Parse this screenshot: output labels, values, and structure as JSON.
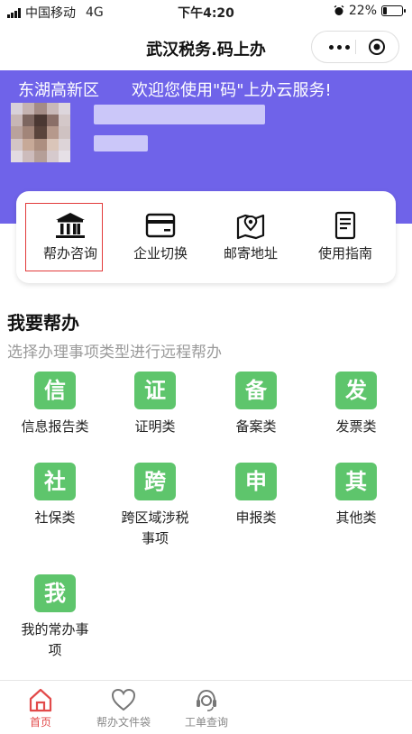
{
  "status_bar": {
    "carrier": "中国移动",
    "network": "4G",
    "time": "下午4:20",
    "battery": "22%",
    "battery_level": 0.22
  },
  "nav": {
    "title": "武汉税务.码上办"
  },
  "hero": {
    "district": "东湖高新区",
    "welcome": "欢迎您使用\"码\"上办云服务!"
  },
  "quick_actions": [
    {
      "label": "帮办咨询",
      "icon": "bank-icon"
    },
    {
      "label": "企业切换",
      "icon": "card-icon"
    },
    {
      "label": "邮寄地址",
      "icon": "map-icon"
    },
    {
      "label": "使用指南",
      "icon": "document-icon"
    }
  ],
  "section": {
    "title": "我要帮办",
    "subtitle": "选择办理事项类型进行远程帮办"
  },
  "categories": [
    {
      "char": "信",
      "label": "信息报告类"
    },
    {
      "char": "证",
      "label": "证明类"
    },
    {
      "char": "备",
      "label": "备案类"
    },
    {
      "char": "发",
      "label": "发票类"
    },
    {
      "char": "社",
      "label": "社保类"
    },
    {
      "char": "跨",
      "label": "跨区域涉税事项"
    },
    {
      "char": "申",
      "label": "申报类"
    },
    {
      "char": "其",
      "label": "其他类"
    },
    {
      "char": "我",
      "label": "我的常办事项"
    }
  ],
  "tabbar": [
    {
      "label": "首页",
      "icon": "home-icon",
      "active": true
    },
    {
      "label": "帮办文件袋",
      "icon": "heart-icon",
      "active": false
    },
    {
      "label": "工单查询",
      "icon": "headset-icon",
      "active": false
    }
  ],
  "colors": {
    "accent_purple": "#6f63e9",
    "tile_green": "#5ec56c",
    "active_tab": "#e24a4a",
    "highlight": "#e23b3b"
  }
}
